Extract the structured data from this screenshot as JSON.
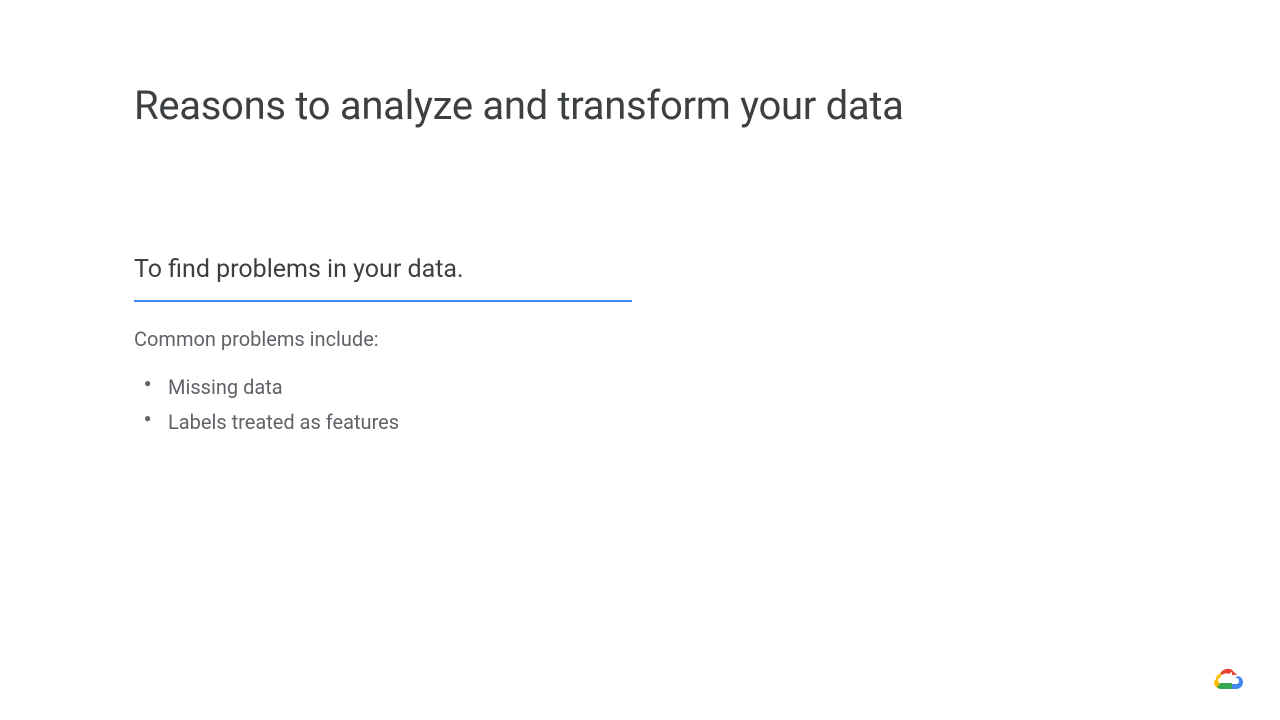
{
  "title": "Reasons to analyze and transform your data",
  "subtitle": "To find problems in your data.",
  "intro": "Common problems include:",
  "bullets": [
    "Missing data",
    "Labels treated as features"
  ]
}
